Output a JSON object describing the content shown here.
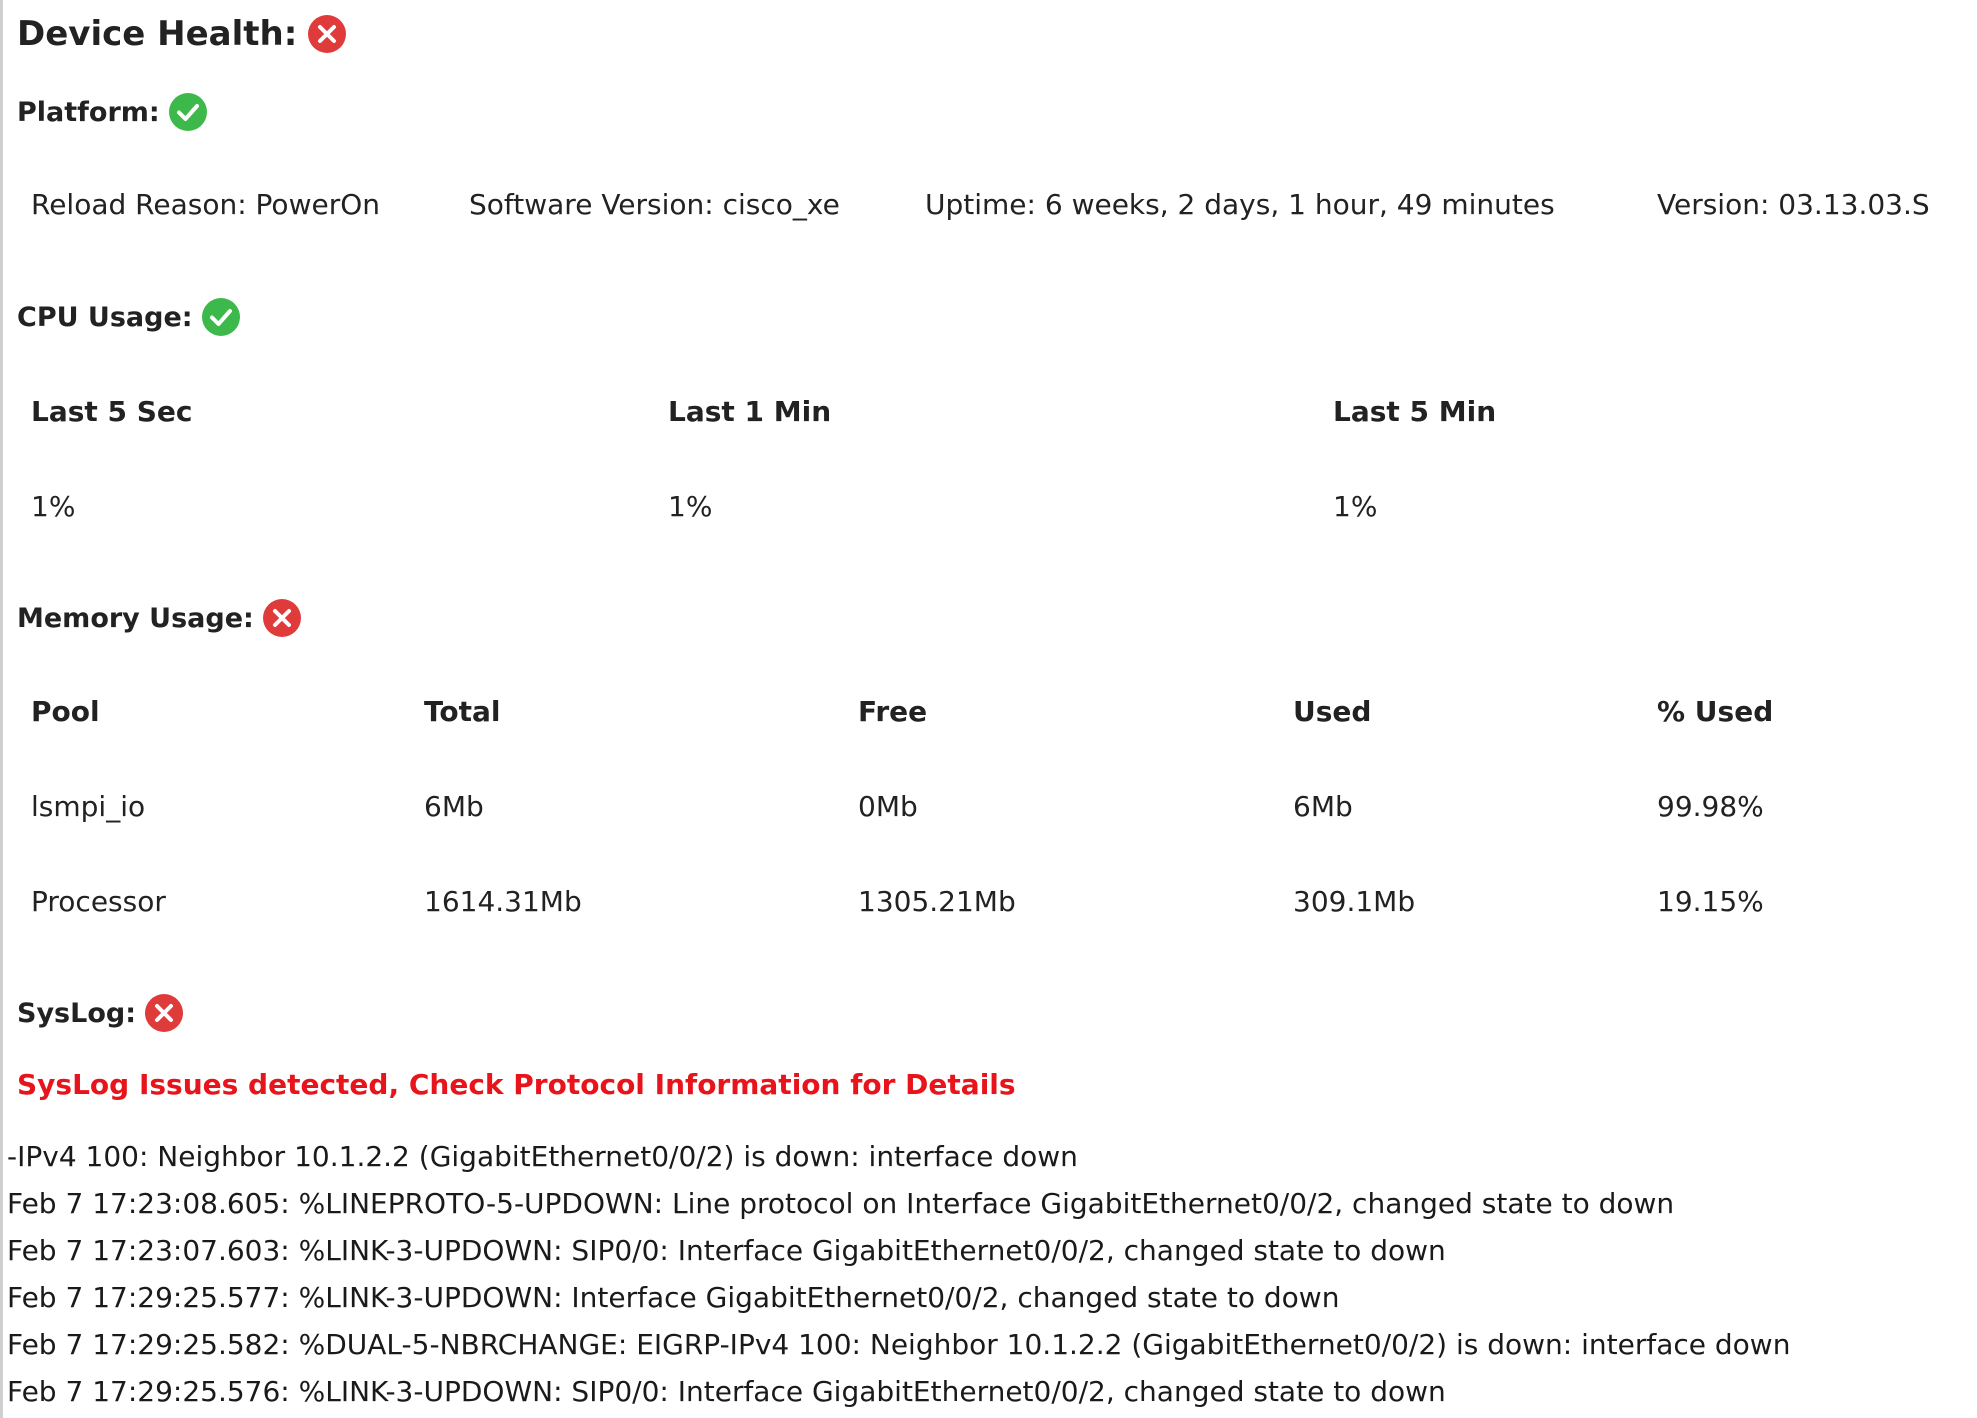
{
  "device_health": {
    "label": "Device Health:",
    "status_icon": "error-icon"
  },
  "platform": {
    "label": "Platform:",
    "status_icon": "check-icon",
    "reload_reason": "Reload Reason: PowerOn",
    "software_version": "Software Version: cisco_xe",
    "uptime": "Uptime: 6 weeks, 2 days, 1 hour, 49 minutes",
    "version": "Version: 03.13.03.S"
  },
  "cpu": {
    "label": "CPU Usage:",
    "status_icon": "check-icon",
    "headers": [
      "Last 5 Sec",
      "Last 1 Min",
      "Last 5 Min"
    ],
    "values": [
      "1%",
      "1%",
      "1%"
    ]
  },
  "memory": {
    "label": "Memory Usage:",
    "status_icon": "error-icon",
    "headers": [
      "Pool",
      "Total",
      "Free",
      "Used",
      "% Used"
    ],
    "rows": [
      [
        "lsmpi_io",
        "6Mb",
        "0Mb",
        "6Mb",
        "99.98%"
      ],
      [
        "Processor",
        "1614.31Mb",
        "1305.21Mb",
        "309.1Mb",
        "19.15%"
      ]
    ]
  },
  "syslog": {
    "label": "SysLog:",
    "status_icon": "error-icon",
    "message": "SysLog Issues detected, Check Protocol Information for Details",
    "lines": [
      "-IPv4 100: Neighbor 10.1.2.2 (GigabitEthernet0/0/2) is down: interface down",
      "Feb 7 17:23:08.605: %LINEPROTO-5-UPDOWN: Line protocol on Interface GigabitEthernet0/0/2, changed state to down",
      "Feb 7 17:23:07.603: %LINK-3-UPDOWN: SIP0/0: Interface GigabitEthernet0/0/2, changed state to down",
      "Feb 7 17:29:25.577: %LINK-3-UPDOWN: Interface GigabitEthernet0/0/2, changed state to down",
      "Feb 7 17:29:25.582: %DUAL-5-NBRCHANGE: EIGRP-IPv4 100: Neighbor 10.1.2.2 (GigabitEthernet0/0/2) is down: interface down",
      "Feb 7 17:29:25.576: %LINK-3-UPDOWN: SIP0/0: Interface GigabitEthernet0/0/2, changed state to down"
    ]
  },
  "colors": {
    "error": "#e03b3b",
    "ok": "#3cb94a",
    "alert_text": "#e8141c"
  }
}
